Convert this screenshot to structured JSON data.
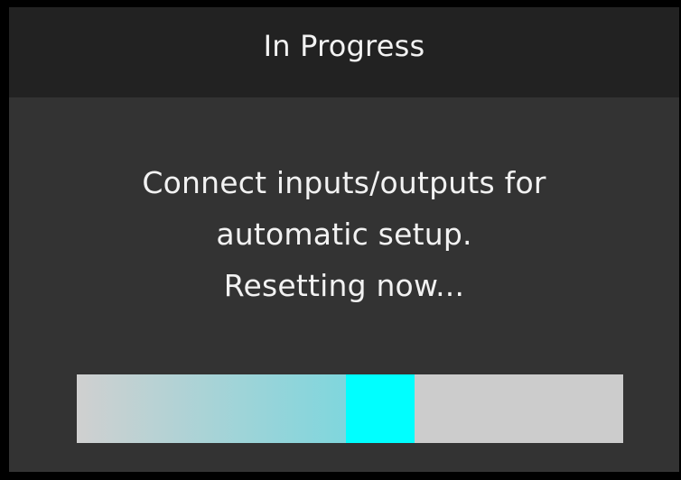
{
  "dialog": {
    "title": "In Progress",
    "message_lines": [
      "Connect inputs/outputs for",
      "automatic setup.",
      "Resetting now..."
    ]
  },
  "progress": {
    "indicator_position": 0.555,
    "trail_start_color": "#d0d0d0",
    "trail_end_color": "#7fd6dd",
    "head_color": "#00ffff",
    "track_color": "#cccccc"
  },
  "colors": {
    "frame": "#000000",
    "background": "#333333",
    "header": "#222222",
    "text": "#f2f2f2"
  }
}
